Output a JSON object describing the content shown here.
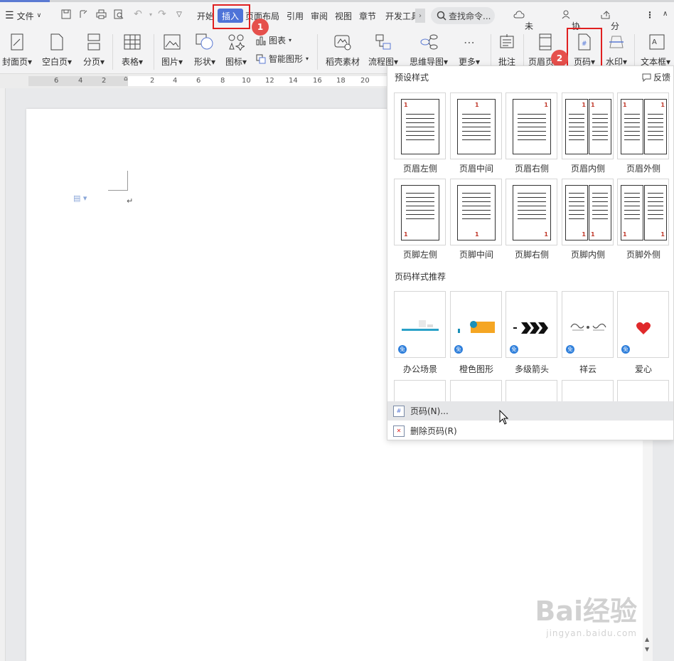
{
  "menubar": {
    "file_label": "文件",
    "tabs": [
      "开始",
      "插入",
      "页面布局",
      "引用",
      "审阅",
      "视图",
      "章节",
      "开发工具"
    ],
    "active_tab": "插入",
    "search_placeholder": "查找命令...",
    "unsaved": "未保存",
    "collab": "协作",
    "share": "分享"
  },
  "ribbon": {
    "cover": "封面页",
    "blank": "空白页",
    "pagebreak": "分页",
    "table": "表格",
    "picture": "图片",
    "shape": "形状",
    "icon": "图标",
    "chart": "图表",
    "smartart": "智能图形",
    "docer": "稻壳素材",
    "flow": "流程图",
    "mindmap": "思维导图",
    "more": "更多",
    "comment": "批注",
    "header_footer": "页眉页脚",
    "page_number": "页码",
    "watermark": "水印",
    "textbox": "文本框"
  },
  "ruler_numbers": [
    "6",
    "4",
    "2",
    "2",
    "4",
    "6",
    "8",
    "10",
    "12",
    "14",
    "16",
    "18",
    "20"
  ],
  "badges": [
    "1",
    "2"
  ],
  "panel": {
    "title": "预设样式",
    "feedback": "反馈",
    "presets_row1": [
      "页眉左侧",
      "页眉中间",
      "页眉右侧",
      "页眉内侧",
      "页眉外侧"
    ],
    "presets_row2": [
      "页脚左侧",
      "页脚中间",
      "页脚右侧",
      "页脚内侧",
      "页脚外侧"
    ],
    "preset_number": "1",
    "recommend_title": "页码样式推荐",
    "recommend": [
      "办公场景",
      "橙色图形",
      "多级箭头",
      "祥云",
      "爱心"
    ],
    "free_tag": "免",
    "menu_page_number": "页码(N)...",
    "menu_delete": "删除页码(R)"
  },
  "doc": {
    "para_mark": "↵"
  },
  "watermark": {
    "brand": "Bai经验",
    "url": "jingyan.baidu.com"
  },
  "colors": {
    "accent": "#4e73d8",
    "highlight": "#e02020",
    "badge": "#e5504c"
  }
}
